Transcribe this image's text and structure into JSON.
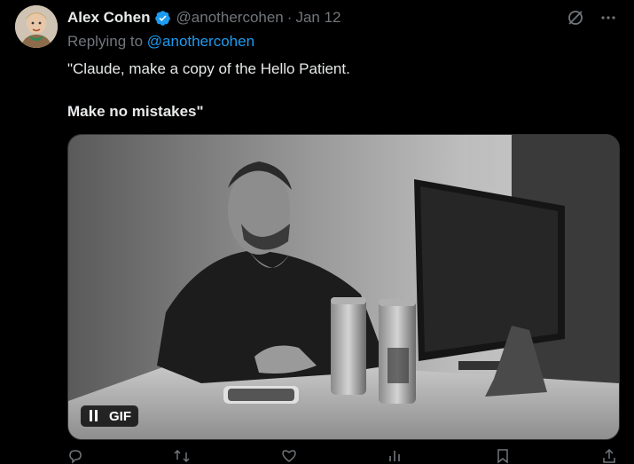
{
  "author": {
    "name": "Alex Cohen",
    "handle": "@anothercohen",
    "separator": "·",
    "date": "Jan 12"
  },
  "reply": {
    "prefix": "Replying to",
    "mention": "@anothercohen"
  },
  "tweet": {
    "line1": "\"Claude, make a copy of the Hello Patient.",
    "line2": "Make no mistakes\""
  },
  "media": {
    "badge_label": "GIF"
  },
  "icons": {
    "verified": "verified-badge-icon",
    "grok": "grok-icon",
    "more": "more-icon",
    "pause": "pause-icon",
    "actions": [
      "reply-icon",
      "retweet-icon",
      "like-icon",
      "views-icon",
      "bookmark-icon",
      "share-icon"
    ]
  },
  "colors": {
    "background": "#000000",
    "text": "#e7e9ea",
    "secondary": "#71767b",
    "accent": "#1d9bf0"
  }
}
